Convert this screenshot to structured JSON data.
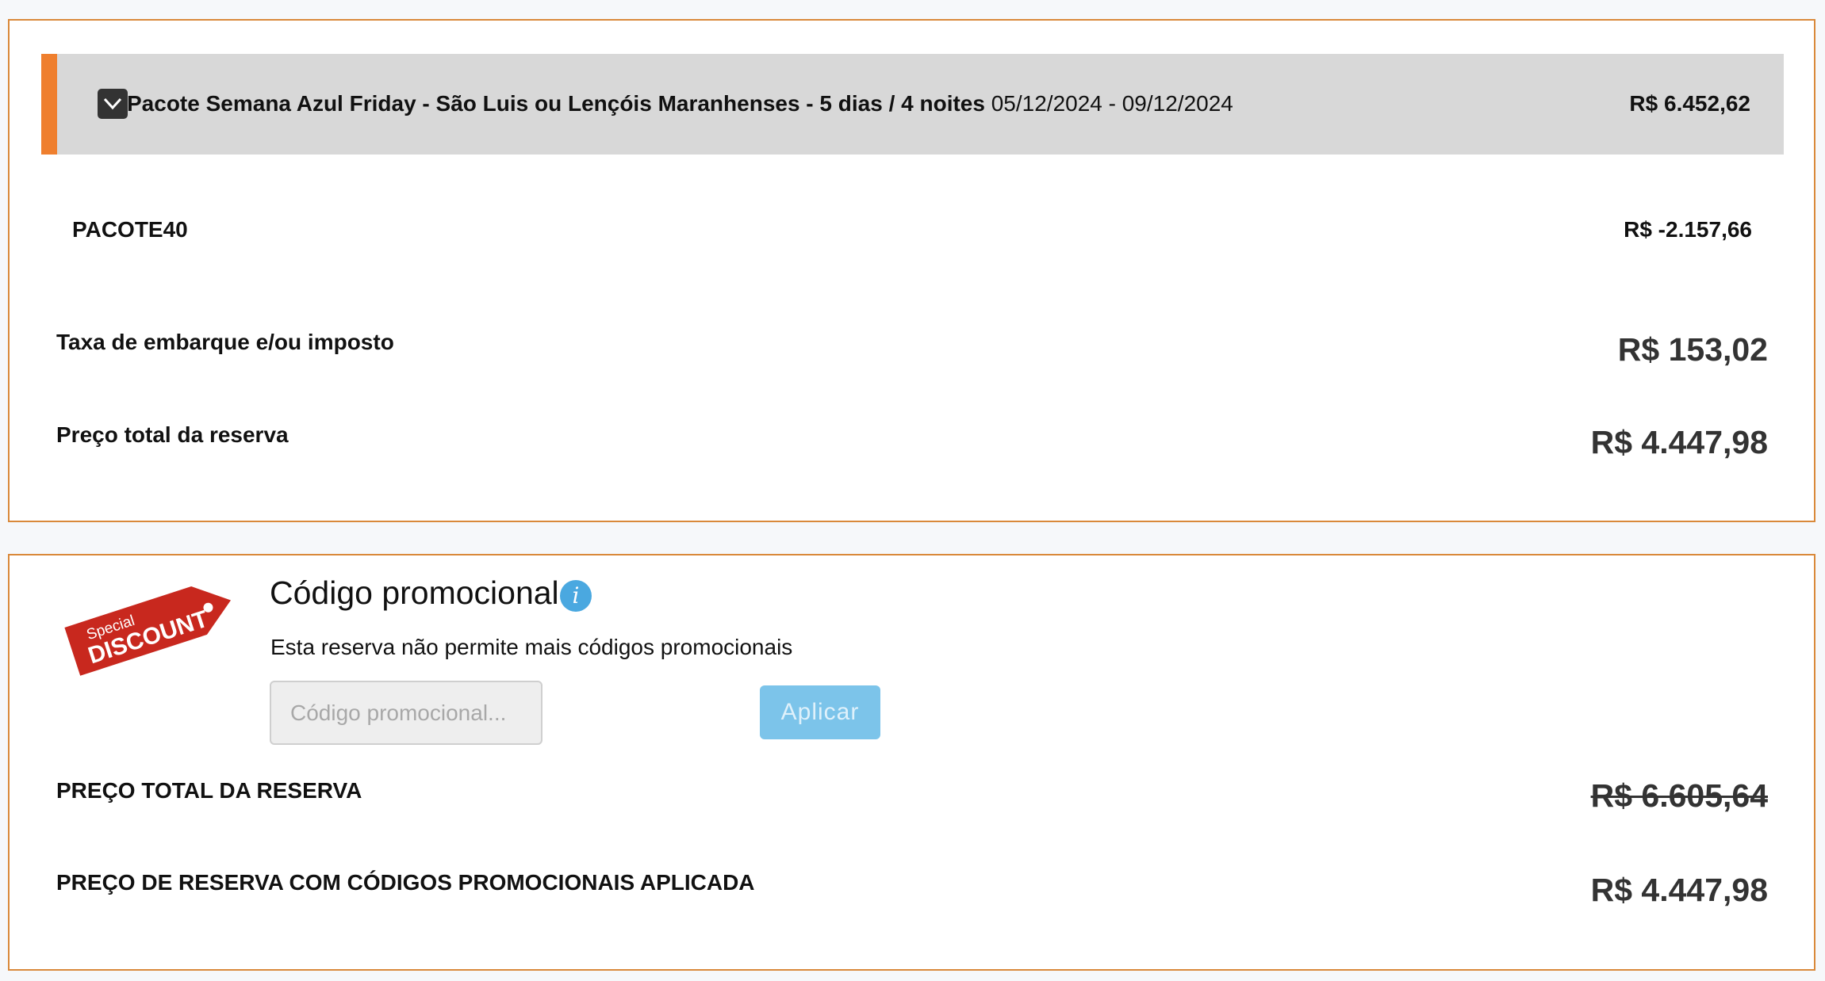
{
  "package": {
    "name": "Pacote Semana Azul Friday - São Luis ou Lençóis Maranhenses - 5 dias / 4 noites",
    "dates": "05/12/2024 - 09/12/2024",
    "price": "R$ 6.452,62",
    "toggle_icon": "chevron-down-icon"
  },
  "discount_line": {
    "label": "PACOTE40",
    "value": "R$ -2.157,66"
  },
  "tax_line": {
    "label": "Taxa de embarque e/ou imposto",
    "value": "R$ 153,02"
  },
  "total_line": {
    "label": "Preço total da reserva",
    "value": "R$ 4.447,98"
  },
  "promo": {
    "tag_top": "Special",
    "tag_bottom": "DISCOUNT",
    "title": "Código promocional",
    "info_icon": "i",
    "note": "Esta reserva não permite mais códigos promocionais",
    "input_placeholder": "Código promocional...",
    "apply_label": "Aplicar"
  },
  "totals": {
    "grand_label": "PREÇO TOTAL DA RESERVA",
    "grand_value": "R$ 6.605,64",
    "final_label": "PREÇO DE RESERVA COM CÓDIGOS PROMOCIONAIS APLICADA",
    "final_value": "R$ 4.447,98"
  },
  "colors": {
    "accent_orange": "#ef7f2e",
    "card_border": "#d9893a",
    "tag_red": "#c8281e",
    "button_blue": "#7cc4ea",
    "info_blue": "#4aa8e0"
  }
}
